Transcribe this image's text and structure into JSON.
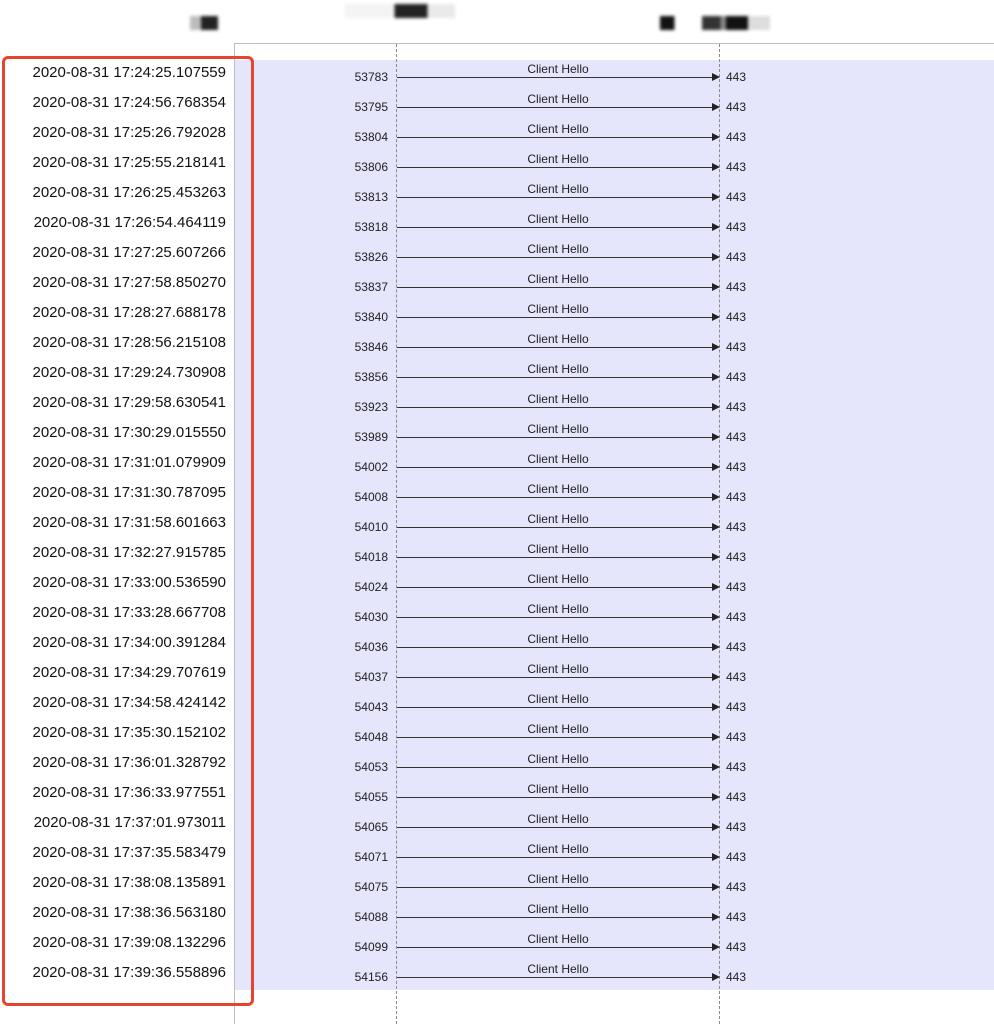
{
  "header": {
    "labels": [
      "",
      "",
      ""
    ]
  },
  "colors": {
    "flow_background": "#e5e5fb",
    "highlight_border": "#e5452f",
    "arrow": "#222222"
  },
  "rows": [
    {
      "time": "2020-08-31 17:24:25.107559",
      "src_port": "53783",
      "message": "Client Hello",
      "dst_port": "443"
    },
    {
      "time": "2020-08-31 17:24:56.768354",
      "src_port": "53795",
      "message": "Client Hello",
      "dst_port": "443"
    },
    {
      "time": "2020-08-31 17:25:26.792028",
      "src_port": "53804",
      "message": "Client Hello",
      "dst_port": "443"
    },
    {
      "time": "2020-08-31 17:25:55.218141",
      "src_port": "53806",
      "message": "Client Hello",
      "dst_port": "443"
    },
    {
      "time": "2020-08-31 17:26:25.453263",
      "src_port": "53813",
      "message": "Client Hello",
      "dst_port": "443"
    },
    {
      "time": "2020-08-31 17:26:54.464119",
      "src_port": "53818",
      "message": "Client Hello",
      "dst_port": "443"
    },
    {
      "time": "2020-08-31 17:27:25.607266",
      "src_port": "53826",
      "message": "Client Hello",
      "dst_port": "443"
    },
    {
      "time": "2020-08-31 17:27:58.850270",
      "src_port": "53837",
      "message": "Client Hello",
      "dst_port": "443"
    },
    {
      "time": "2020-08-31 17:28:27.688178",
      "src_port": "53840",
      "message": "Client Hello",
      "dst_port": "443"
    },
    {
      "time": "2020-08-31 17:28:56.215108",
      "src_port": "53846",
      "message": "Client Hello",
      "dst_port": "443"
    },
    {
      "time": "2020-08-31 17:29:24.730908",
      "src_port": "53856",
      "message": "Client Hello",
      "dst_port": "443"
    },
    {
      "time": "2020-08-31 17:29:58.630541",
      "src_port": "53923",
      "message": "Client Hello",
      "dst_port": "443"
    },
    {
      "time": "2020-08-31 17:30:29.015550",
      "src_port": "53989",
      "message": "Client Hello",
      "dst_port": "443"
    },
    {
      "time": "2020-08-31 17:31:01.079909",
      "src_port": "54002",
      "message": "Client Hello",
      "dst_port": "443"
    },
    {
      "time": "2020-08-31 17:31:30.787095",
      "src_port": "54008",
      "message": "Client Hello",
      "dst_port": "443"
    },
    {
      "time": "2020-08-31 17:31:58.601663",
      "src_port": "54010",
      "message": "Client Hello",
      "dst_port": "443"
    },
    {
      "time": "2020-08-31 17:32:27.915785",
      "src_port": "54018",
      "message": "Client Hello",
      "dst_port": "443"
    },
    {
      "time": "2020-08-31 17:33:00.536590",
      "src_port": "54024",
      "message": "Client Hello",
      "dst_port": "443"
    },
    {
      "time": "2020-08-31 17:33:28.667708",
      "src_port": "54030",
      "message": "Client Hello",
      "dst_port": "443"
    },
    {
      "time": "2020-08-31 17:34:00.391284",
      "src_port": "54036",
      "message": "Client Hello",
      "dst_port": "443"
    },
    {
      "time": "2020-08-31 17:34:29.707619",
      "src_port": "54037",
      "message": "Client Hello",
      "dst_port": "443"
    },
    {
      "time": "2020-08-31 17:34:58.424142",
      "src_port": "54043",
      "message": "Client Hello",
      "dst_port": "443"
    },
    {
      "time": "2020-08-31 17:35:30.152102",
      "src_port": "54048",
      "message": "Client Hello",
      "dst_port": "443"
    },
    {
      "time": "2020-08-31 17:36:01.328792",
      "src_port": "54053",
      "message": "Client Hello",
      "dst_port": "443"
    },
    {
      "time": "2020-08-31 17:36:33.977551",
      "src_port": "54055",
      "message": "Client Hello",
      "dst_port": "443"
    },
    {
      "time": "2020-08-31 17:37:01.973011",
      "src_port": "54065",
      "message": "Client Hello",
      "dst_port": "443"
    },
    {
      "time": "2020-08-31 17:37:35.583479",
      "src_port": "54071",
      "message": "Client Hello",
      "dst_port": "443"
    },
    {
      "time": "2020-08-31 17:38:08.135891",
      "src_port": "54075",
      "message": "Client Hello",
      "dst_port": "443"
    },
    {
      "time": "2020-08-31 17:38:36.563180",
      "src_port": "54088",
      "message": "Client Hello",
      "dst_port": "443"
    },
    {
      "time": "2020-08-31 17:39:08.132296",
      "src_port": "54099",
      "message": "Client Hello",
      "dst_port": "443"
    },
    {
      "time": "2020-08-31 17:39:36.558896",
      "src_port": "54156",
      "message": "Client Hello",
      "dst_port": "443"
    }
  ]
}
